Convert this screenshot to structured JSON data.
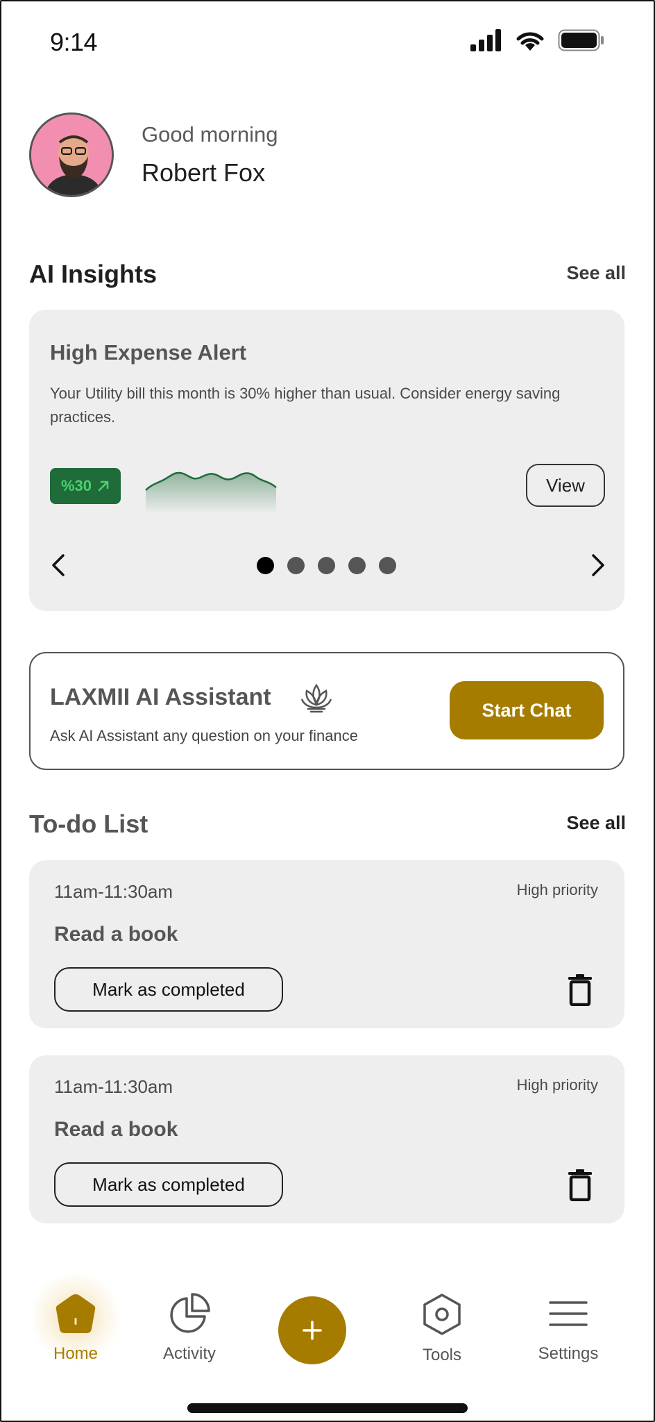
{
  "status_bar": {
    "time": "9:14",
    "icons": [
      "signal-icon",
      "wifi-icon",
      "battery-icon"
    ]
  },
  "greeting": {
    "subtitle": "Good morning",
    "name": "Robert Fox"
  },
  "insights": {
    "title": "AI Insights",
    "see_all": "See all",
    "card": {
      "title": "High Expense Alert",
      "body": "Your Utility bill this month is 30% higher than usual. Consider energy saving practices.",
      "badge": "%30",
      "view_label": "View"
    },
    "pagination": {
      "total": 5,
      "active": 1
    }
  },
  "assistant": {
    "title": "LAXMII AI Assistant",
    "subtitle": "Ask AI Assistant any question on your finance",
    "button_label": "Start Chat"
  },
  "todo": {
    "title": "To-do List",
    "see_all": "See all",
    "items": [
      {
        "time": "11am-11:30am",
        "priority": "High priority",
        "title": "Read a book",
        "action": "Mark as completed"
      },
      {
        "time": "11am-11:30am",
        "priority": "High priority",
        "title": "Read a book",
        "action": "Mark as completed"
      }
    ]
  },
  "nav": {
    "tabs": [
      {
        "label": "Home",
        "icon": "home-icon",
        "active": true
      },
      {
        "label": "Activity",
        "icon": "pie-chart-icon",
        "active": false
      },
      {
        "label": "Tools",
        "icon": "hexagon-icon",
        "active": false
      },
      {
        "label": "Settings",
        "icon": "menu-icon",
        "active": false
      }
    ],
    "fab_icon": "plus-icon"
  },
  "colors": {
    "accent": "#a67c00",
    "badge_bg": "#1f6b3a",
    "badge_text": "#4bd06e",
    "card_bg": "#eeeeee"
  }
}
